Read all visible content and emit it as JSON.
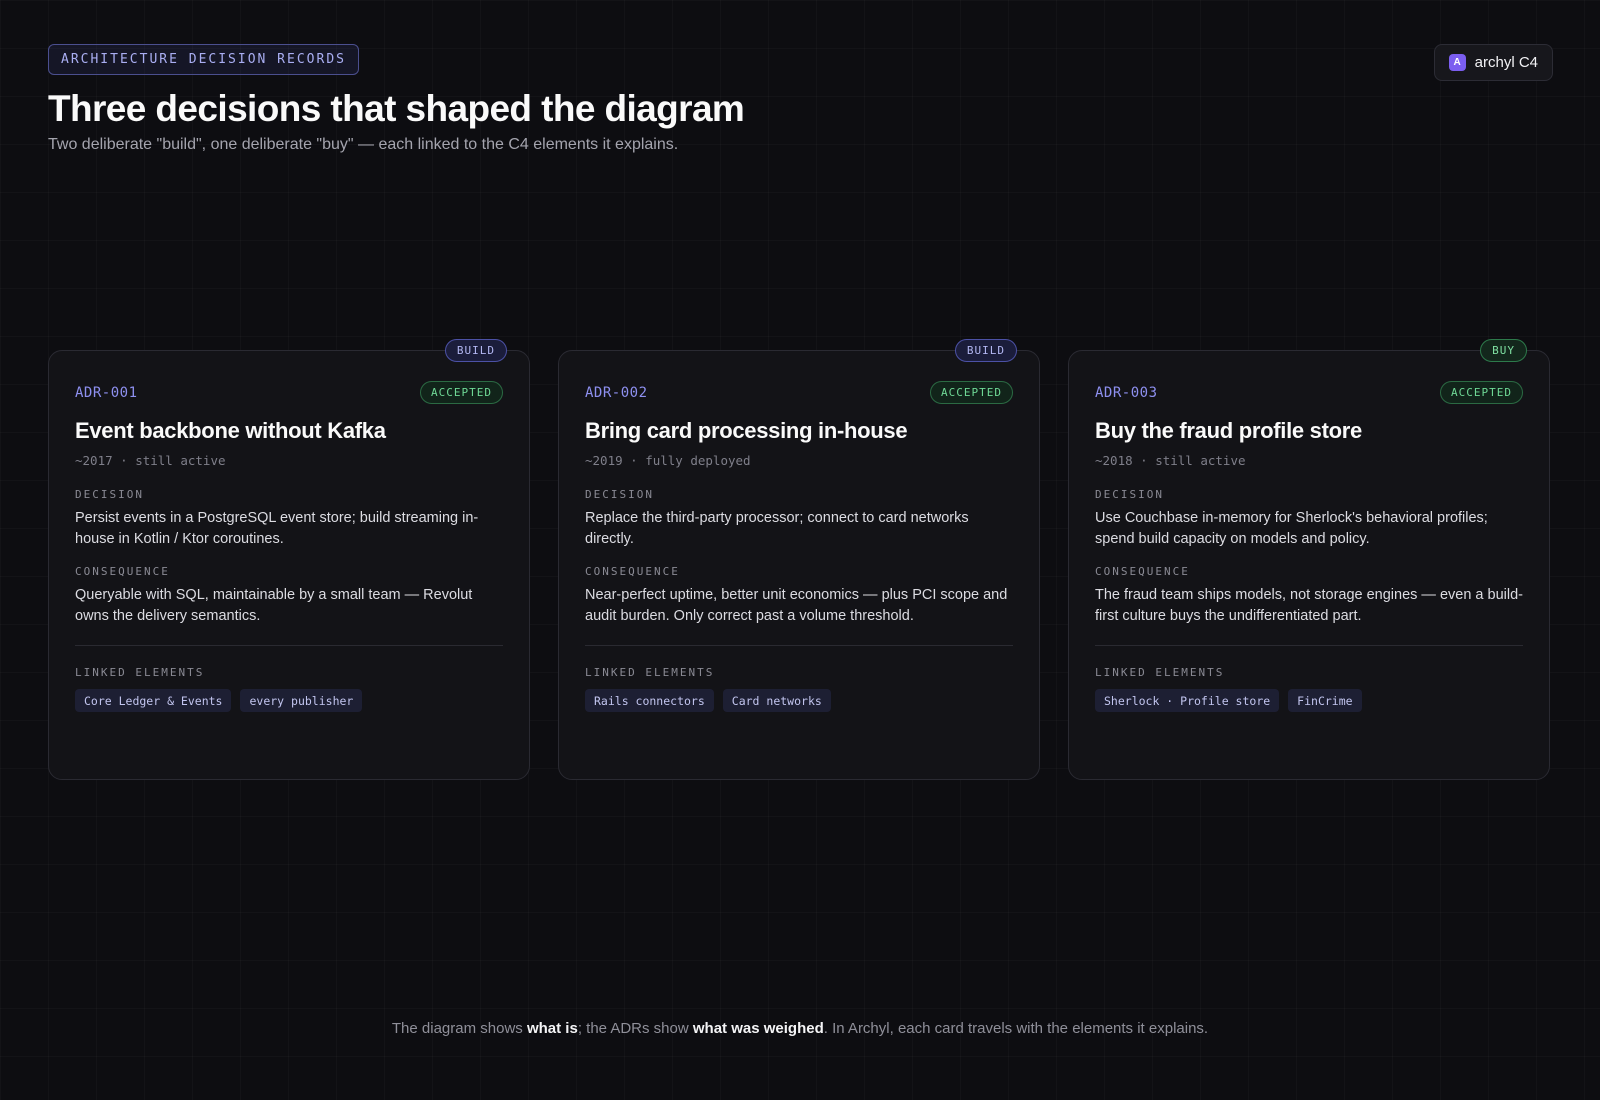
{
  "header": {
    "eyebrow": "ARCHITECTURE DECISION RECORDS",
    "title": "Three decisions that shaped the diagram",
    "subtitle": "Two deliberate \"build\", one deliberate \"buy\" — each linked to the C4 elements it explains."
  },
  "brand": {
    "icon_letter": "A",
    "icon": "archyl-logo-icon",
    "label": "archyl C4"
  },
  "labels": {
    "decision": "DECISION",
    "consequence": "CONSEQUENCE",
    "linked": "LINKED ELEMENTS"
  },
  "cards": [
    {
      "kind": "BUILD",
      "id": "ADR-001",
      "status": "ACCEPTED",
      "title": "Event backbone without Kafka",
      "meta": "~2017 · still active",
      "decision": "Persist events in a PostgreSQL event store; build streaming in-house in Kotlin / Ktor coroutines.",
      "consequence": "Queryable with SQL, maintainable by a small team — Revolut owns the delivery semantics.",
      "linked": [
        "Core Ledger & Events",
        "every publisher"
      ]
    },
    {
      "kind": "BUILD",
      "id": "ADR-002",
      "status": "ACCEPTED",
      "title": "Bring card processing in-house",
      "meta": "~2019 · fully deployed",
      "decision": "Replace the third-party processor; connect to card networks directly.",
      "consequence": "Near-perfect uptime, better unit economics — plus PCI scope and audit burden. Only correct past a volume threshold.",
      "linked": [
        "Rails connectors",
        "Card networks"
      ]
    },
    {
      "kind": "BUY",
      "id": "ADR-003",
      "status": "ACCEPTED",
      "title": "Buy the fraud profile store",
      "meta": "~2018 · still active",
      "decision": "Use Couchbase in-memory for Sherlock's behavioral profiles; spend build capacity on models and policy.",
      "consequence": "The fraud team ships models, not storage engines — even a build-first culture buys the undifferentiated part.",
      "linked": [
        "Sherlock · Profile store",
        "FinCrime"
      ]
    }
  ],
  "footer": {
    "part1": "The diagram shows ",
    "bold1": "what is",
    "part2": "; the ADRs show ",
    "bold2": "what was weighed",
    "part3": ". In Archyl, each card travels with the elements it explains."
  }
}
